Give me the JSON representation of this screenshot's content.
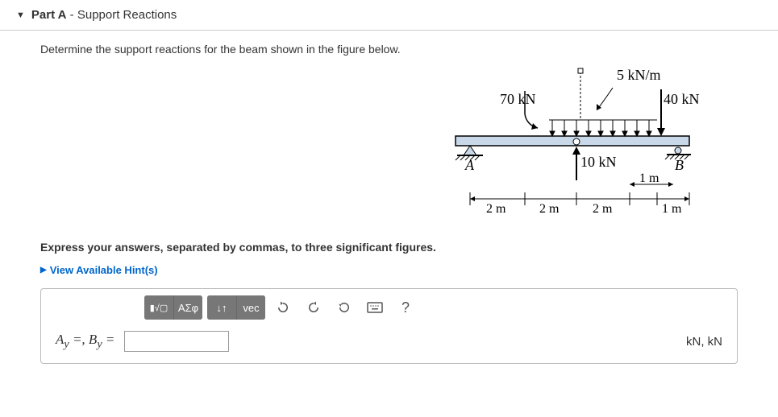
{
  "header": {
    "part": "Part A",
    "title": " - Support Reactions"
  },
  "prompt": "Determine the support reactions for the beam shown in the figure below.",
  "figure": {
    "dist_load": "5 kN/m",
    "load_left": "70 kN",
    "load_right": "40 kN",
    "load_up": "10 kN",
    "pointA": "A",
    "pointB": "B",
    "dim1": "2 m",
    "dim2": "2 m",
    "dim3": "2 m",
    "dim4": "1 m",
    "dim5": "1 m"
  },
  "express": "Express your answers, separated by commas, to three significant figures.",
  "hints_label": "View Available Hint(s)",
  "toolbar": {
    "templates_sym": "▮√▢",
    "greek": "ΑΣφ",
    "subsup": "↓↑",
    "vec": "vec",
    "help": "?"
  },
  "answer": {
    "vars": "Ay =, By =",
    "units": "kN, kN"
  }
}
